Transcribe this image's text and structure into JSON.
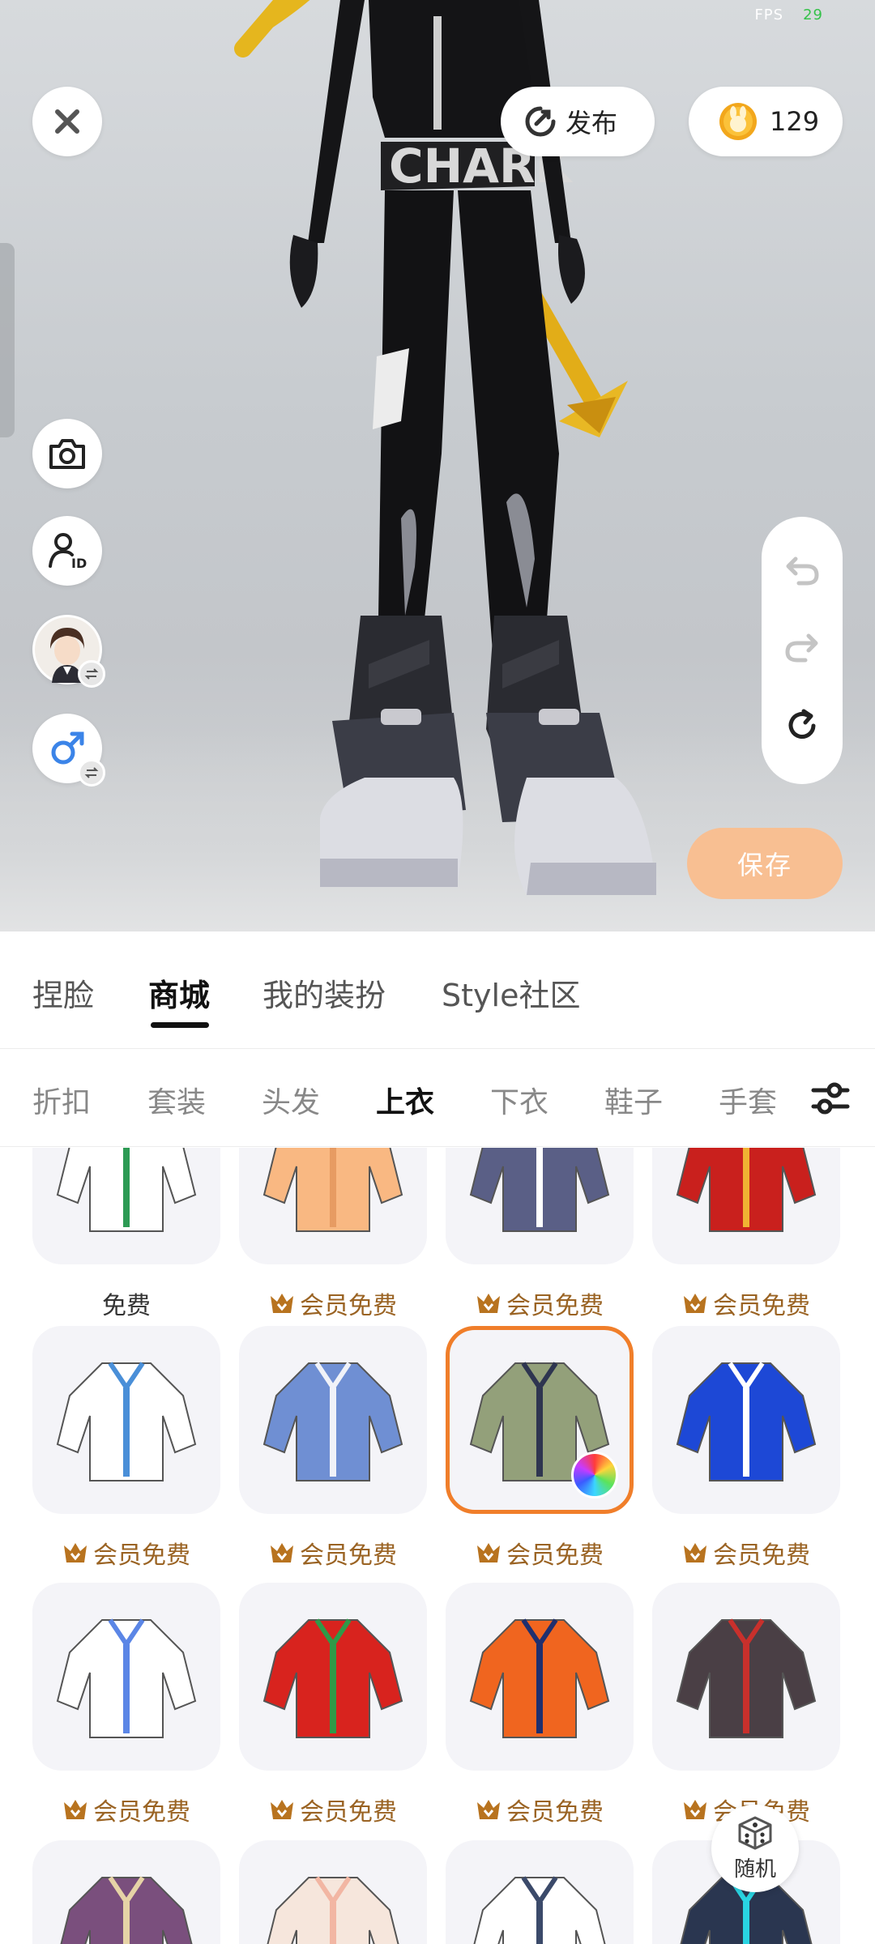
{
  "status": {
    "fps_label": "FPS",
    "fps_value": "29"
  },
  "top": {
    "publish_label": "发布",
    "coins": "129"
  },
  "actions": {
    "save_label": "保存"
  },
  "main_tabs": [
    {
      "label": "捏脸"
    },
    {
      "label": "商城"
    },
    {
      "label": "我的装扮"
    },
    {
      "label": "Style社区"
    }
  ],
  "main_tab_active": "商城",
  "sub_tabs": [
    {
      "label": "折扣"
    },
    {
      "label": "套装"
    },
    {
      "label": "头发"
    },
    {
      "label": "上衣"
    },
    {
      "label": "下衣"
    },
    {
      "label": "鞋子"
    },
    {
      "label": "手套"
    }
  ],
  "sub_tab_active": "上衣",
  "items": [
    {
      "price": "免费",
      "member": false,
      "color": "#ffffff",
      "accent": "#2d9a54"
    },
    {
      "price": "会员免费",
      "member": true,
      "color": "#f9b882",
      "accent": "#e79b62"
    },
    {
      "price": "会员免费",
      "member": true,
      "color": "#5a5f86",
      "accent": "#ffffff"
    },
    {
      "price": "会员免费",
      "member": true,
      "color": "#c9201d",
      "accent": "#f0b233"
    },
    {
      "price": "会员免费",
      "member": true,
      "color": "#ffffff",
      "accent": "#4a8fd8"
    },
    {
      "price": "会员免费",
      "member": true,
      "color": "#6f8fd3",
      "accent": "#f0f2f8"
    },
    {
      "price": "会员免费",
      "member": true,
      "color": "#93a07a",
      "accent": "#2e3550",
      "selected": true
    },
    {
      "price": "会员免费",
      "member": true,
      "color": "#1d48d6",
      "accent": "#ffffff"
    },
    {
      "price": "会员免费",
      "member": true,
      "color": "#ffffff",
      "accent": "#5b86e6"
    },
    {
      "price": "会员免费",
      "member": true,
      "color": "#d8231e",
      "accent": "#2f9a48"
    },
    {
      "price": "会员免费",
      "member": true,
      "color": "#f0651f",
      "accent": "#1f2f6e"
    },
    {
      "price": "会员免费",
      "member": true,
      "color": "#4a3f45",
      "accent": "#c8302c"
    },
    {
      "price": "",
      "member": false,
      "color": "#7a4f7d",
      "accent": "#e6d3a6"
    },
    {
      "price": "",
      "member": false,
      "color": "#f6e6dc",
      "accent": "#f2b6a3"
    },
    {
      "price": "",
      "member": false,
      "color": "#ffffff",
      "accent": "#3b4a6a"
    },
    {
      "price": "",
      "member": false,
      "color": "#2a3650",
      "accent": "#29d4e2"
    }
  ],
  "random": {
    "label": "随机"
  },
  "colors": {
    "accent_orange": "#f07e2a",
    "member_text": "#9a6323",
    "save_button": "#f8bf92"
  }
}
